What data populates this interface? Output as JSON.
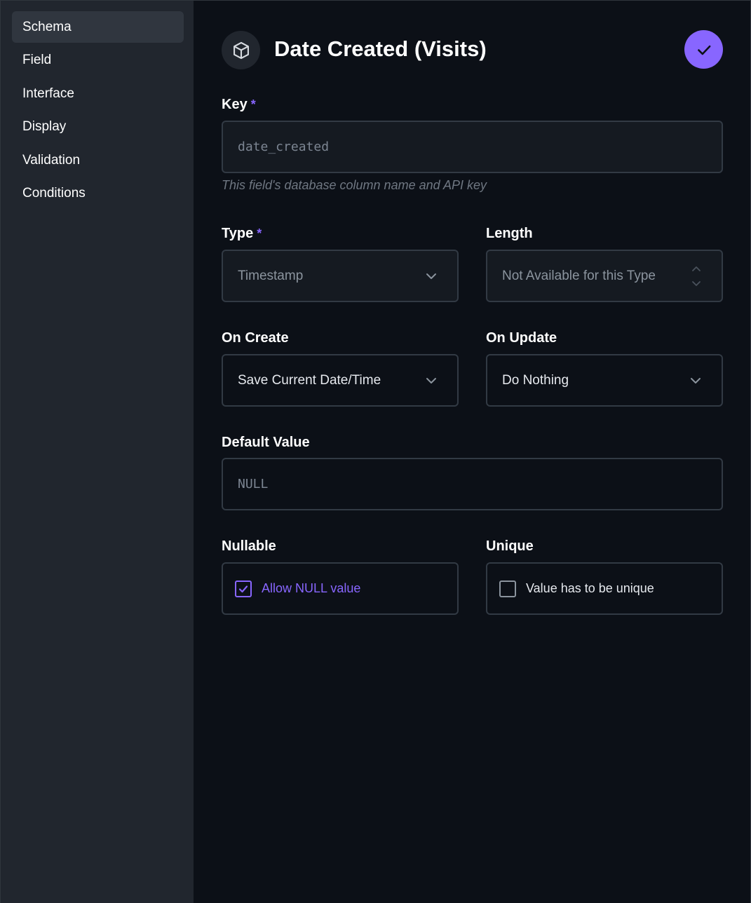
{
  "sidebar": {
    "items": [
      {
        "label": "Schema",
        "active": true
      },
      {
        "label": "Field"
      },
      {
        "label": "Interface"
      },
      {
        "label": "Display"
      },
      {
        "label": "Validation"
      },
      {
        "label": "Conditions"
      }
    ]
  },
  "header": {
    "title": "Date Created (Visits)",
    "icon": "cube-icon",
    "save_icon": "check-icon"
  },
  "form": {
    "key": {
      "label": "Key",
      "required_mark": "*",
      "value": "date_created",
      "hint": "This field's database column name and API key"
    },
    "type": {
      "label": "Type",
      "required_mark": "*",
      "value": "Timestamp"
    },
    "length": {
      "label": "Length",
      "placeholder": "Not Available for this Type"
    },
    "on_create": {
      "label": "On Create",
      "value": "Save Current Date/Time"
    },
    "on_update": {
      "label": "On Update",
      "value": "Do Nothing"
    },
    "default_value": {
      "label": "Default Value",
      "placeholder": "NULL"
    },
    "nullable": {
      "label": "Nullable",
      "checkbox_label": "Allow NULL value",
      "checked": true
    },
    "unique": {
      "label": "Unique",
      "checkbox_label": "Value has to be unique",
      "checked": false
    }
  },
  "colors": {
    "accent": "#8866ff",
    "sidebar_bg": "#21262e",
    "main_bg": "#0c1017",
    "input_bg": "#151a21",
    "border": "#323a44"
  }
}
